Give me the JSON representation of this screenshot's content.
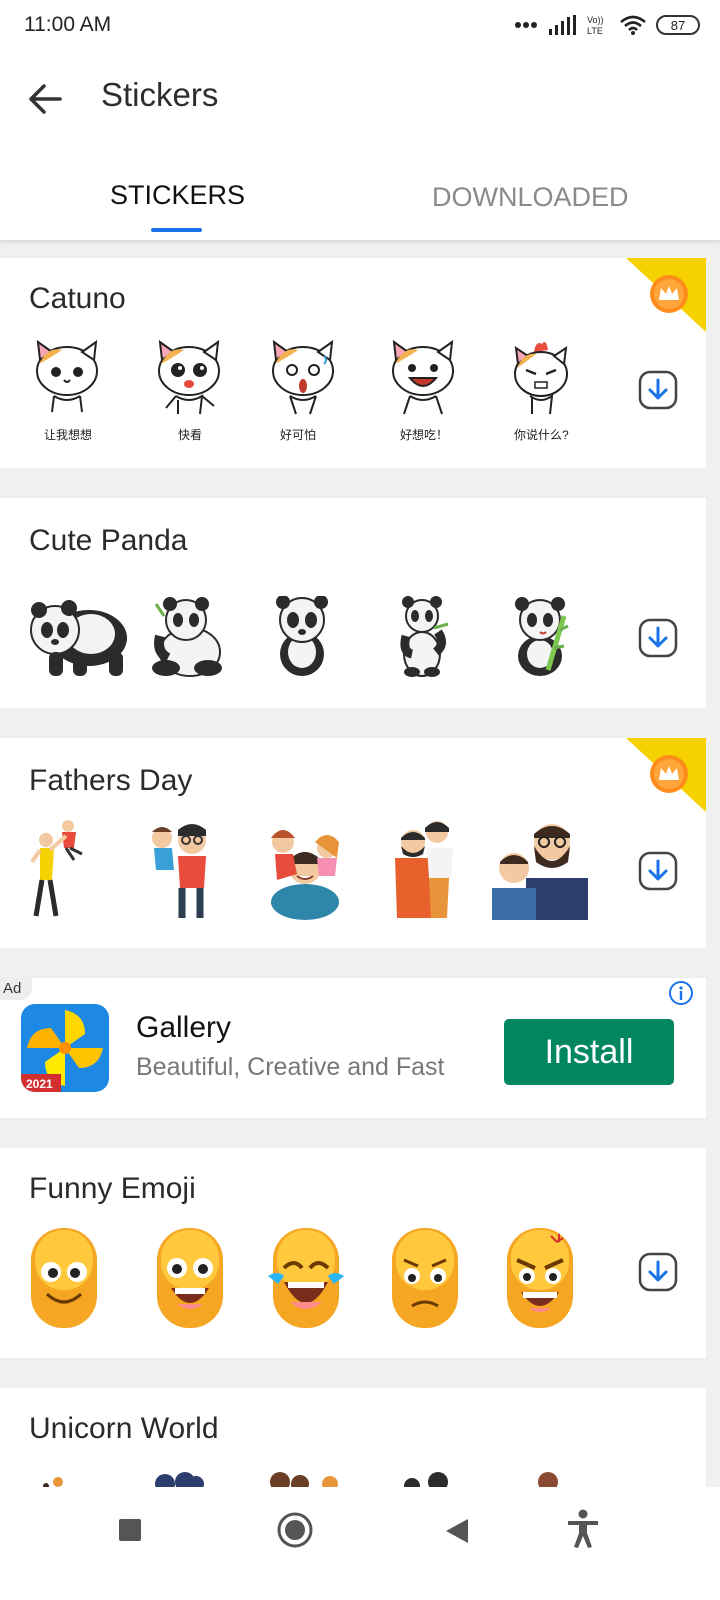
{
  "status": {
    "time": "11:00 AM",
    "network": "Vo LTE",
    "battery": "87"
  },
  "appbar": {
    "title": "Stickers",
    "back_icon": "arrow-left-icon"
  },
  "tabs": [
    {
      "label": "STICKERS",
      "active": true
    },
    {
      "label": "DOWNLOADED",
      "active": false
    }
  ],
  "packs": [
    {
      "title": "Catuno",
      "premium": true,
      "stickers": [
        "cat-think-sticker",
        "cat-look-sticker",
        "cat-scared-sticker",
        "cat-hungry-sticker",
        "cat-angry-sticker"
      ],
      "captions": [
        "让我想想",
        "快看",
        "好可怕",
        "好想吃！",
        "你说什么?"
      ]
    },
    {
      "title": "Cute Panda",
      "premium": false,
      "stickers": [
        "panda-walking-sticker",
        "panda-bamboo-sitting-sticker",
        "panda-front-sticker",
        "panda-eating-sticker",
        "panda-bamboo-sticker"
      ]
    },
    {
      "title": "Fathers Day",
      "premium": true,
      "stickers": [
        "father-lifting-child-sticker",
        "father-child-shoulder-sticker",
        "father-family-sticker",
        "father-son-hug-sticker",
        "father-bearded-son-sticker"
      ]
    },
    {
      "title": "Funny Emoji",
      "premium": false,
      "stickers": [
        "emoji-smile-sticker",
        "emoji-happy-sticker",
        "emoji-laugh-tears-sticker",
        "emoji-worried-sticker",
        "emoji-angry-sticker"
      ]
    },
    {
      "title": "Unicorn World",
      "premium": false,
      "stickers": []
    }
  ],
  "ad": {
    "tag": "Ad",
    "title": "Gallery",
    "subtitle": "Beautiful, Creative and Fast",
    "cta": "Install",
    "badge": "2021",
    "accent": "#00875f"
  },
  "colors": {
    "accent": "#1a73e8",
    "premium": "#f5d100",
    "background": "#f0f0f0"
  },
  "navbar": [
    "square-icon",
    "circle-home-icon",
    "triangle-back-icon",
    "accessibility-icon"
  ]
}
